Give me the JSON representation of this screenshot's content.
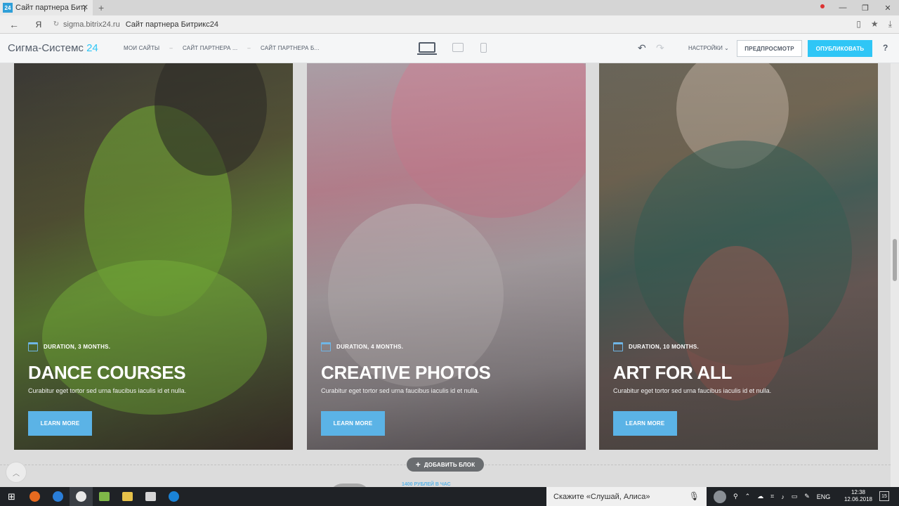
{
  "browser": {
    "tab_favicon": "24",
    "tab_title": "Сайт партнера Битрикс24",
    "tab_close": "✕",
    "new_tab": "+",
    "win_controls": [
      "—",
      "❐",
      "✕"
    ],
    "back": "←",
    "yandex": "Я",
    "domain": "sigma.bitrix24.ru",
    "page_title": "Сайт партнера Битрикс24"
  },
  "editor": {
    "logo_text": "Сигма-Системс",
    "logo_num": "24",
    "breadcrumbs": [
      "МОИ САЙТЫ",
      "САЙТ ПАРТНЕРА ...",
      "САЙТ ПАРТНЕРА Б..."
    ],
    "breadcrumb_sep": "–",
    "settings_label": "НАСТРОЙКИ",
    "preview_label": "ПРЕДПРОСМОТР",
    "publish_label": "ОПУБЛИКОВАТЬ",
    "help_label": "?"
  },
  "cards": [
    {
      "duration": "DURATION, 3 MONTHS.",
      "title": "DANCE COURSES",
      "description": "Curabitur eget tortor sed urna faucibus iaculis id et nulla.",
      "button": "LEARN MORE"
    },
    {
      "duration": "DURATION, 4 MONTHS.",
      "title": "CREATIVE PHOTOS",
      "description": "Curabitur eget tortor sed urna faucibus iaculis id et nulla.",
      "button": "LEARN MORE"
    },
    {
      "duration": "DURATION, 10 MONTHS.",
      "title": "ART FOR ALL",
      "description": "Curabitur eget tortor sed urna faucibus iaculis id et nulla.",
      "button": "LEARN MORE"
    }
  ],
  "canvas": {
    "add_block_label": "ДОБАВИТЬ БЛОК",
    "price_peek": "1400 РУБЛЕЙ В ЧАС"
  },
  "taskbar": {
    "search_placeholder": "Скажите «Слушай, Алиса»",
    "lang": "ENG",
    "time": "12:38",
    "date": "12.06.2018",
    "notifications": "15"
  },
  "colors": {
    "accent": "#2fc6f6",
    "learn_button": "#5bb3e6",
    "text_dark": "#535c69"
  }
}
